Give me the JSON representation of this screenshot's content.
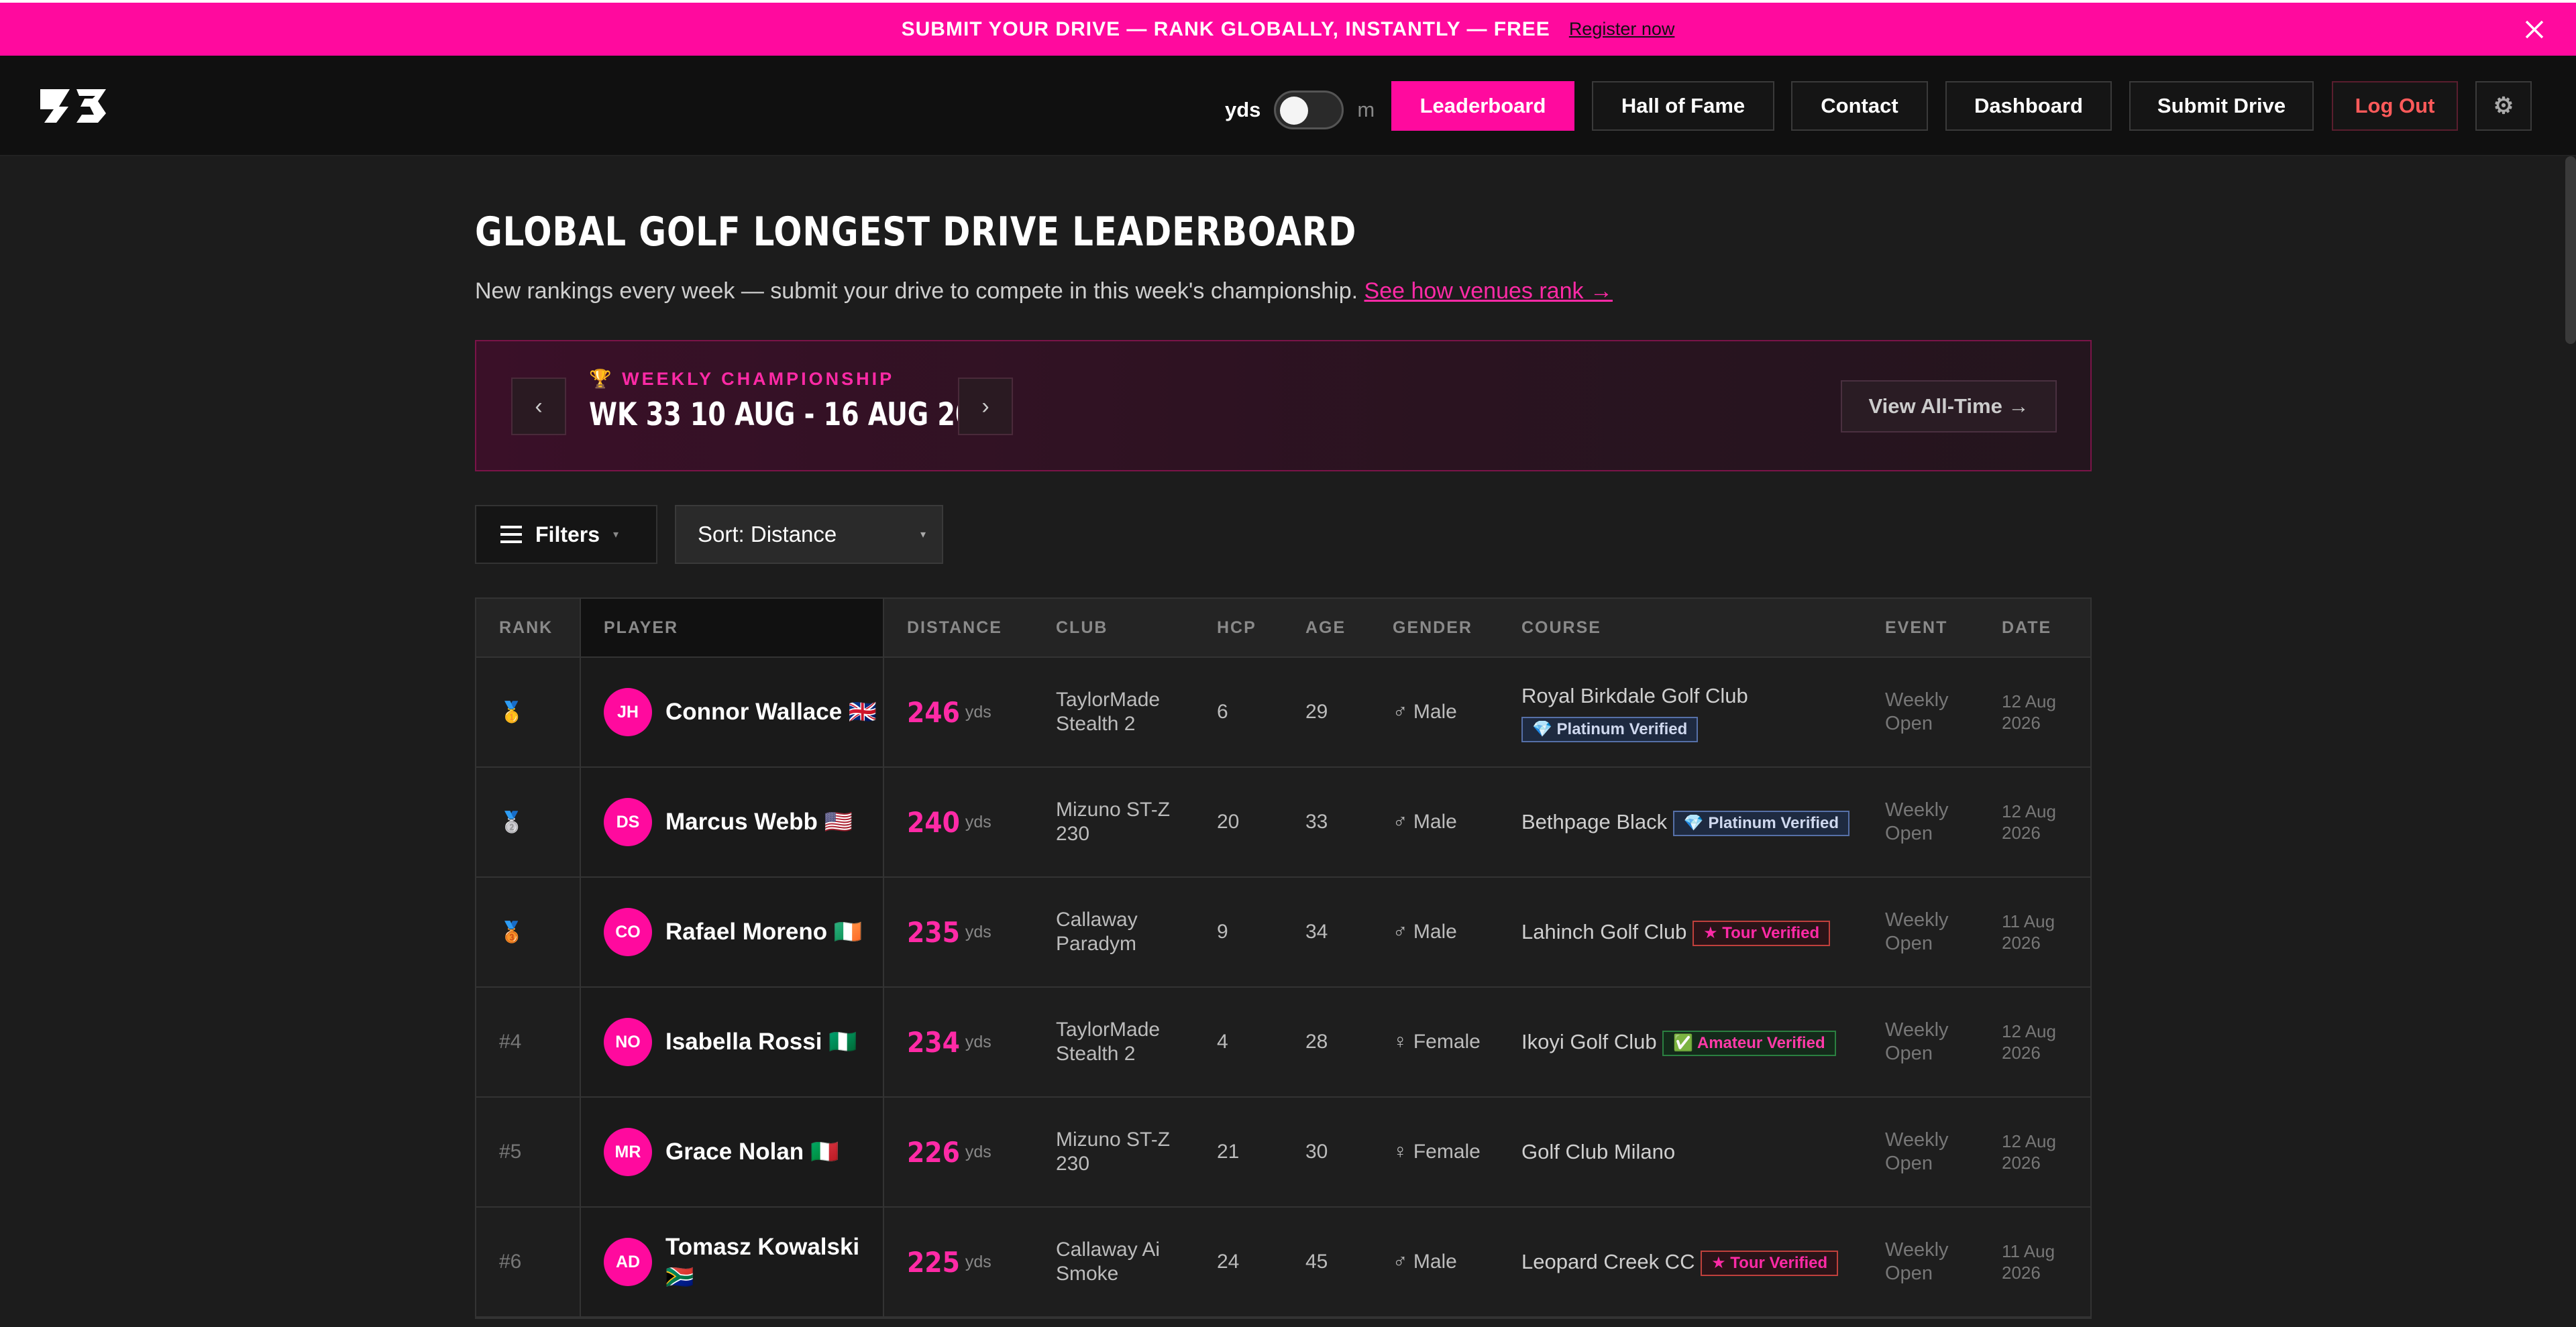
{
  "banner": {
    "text": "SUBMIT YOUR DRIVE — RANK GLOBALLY, INSTANTLY — FREE",
    "link": "Register now",
    "bg": "#ff0a9e"
  },
  "nav": {
    "unit_a": "yds",
    "unit_b": "m",
    "buttons": [
      "Leaderboard",
      "Hall of Fame",
      "Contact",
      "Dashboard",
      "Submit Drive",
      "Log Out"
    ],
    "active": "Leaderboard",
    "settings_icon": "⚙"
  },
  "page": {
    "title": "GLOBAL GOLF LONGEST DRIVE LEADERBOARD",
    "subtitle": "New rankings every week — submit your drive to compete in this week's championship.",
    "subtitle_link": "See how venues rank →"
  },
  "championship": {
    "label": "WEEKLY CHAMPIONSHIP",
    "trophy": "🏆",
    "week": "WK 33 10 AUG - 16 AUG 2026",
    "prev": "‹",
    "next": "›",
    "view_all": "View All-Time →"
  },
  "controls": {
    "filters": "Filters",
    "sort": "Sort: Distance"
  },
  "table": {
    "headers": [
      "RANK",
      "PLAYER",
      "DISTANCE",
      "CLUB",
      "HCP",
      "AGE",
      "GENDER",
      "COURSE",
      "EVENT",
      "DATE"
    ],
    "rows": [
      {
        "rank": "🥇",
        "initials": "JH",
        "name": "Connor Wallace",
        "flag": "🇬🇧",
        "distance": "246",
        "unit": "yds",
        "club": "TaylorMade Stealth 2",
        "hcp": "6",
        "age": "29",
        "gender": "♂ Male",
        "course": "Royal Birkdale Golf Club",
        "badge": "💎 Platinum Verified",
        "event": "Weekly Open",
        "date": "12 Aug 2026"
      },
      {
        "rank": "🥈",
        "initials": "DS",
        "name": "Marcus Webb",
        "flag": "🇺🇸",
        "distance": "240",
        "unit": "yds",
        "club": "Mizuno ST-Z 230",
        "hcp": "20",
        "age": "33",
        "gender": "♂ Male",
        "course": "Bethpage Black",
        "badge": "💎 Platinum Verified",
        "event": "Weekly Open",
        "date": "12 Aug 2026"
      },
      {
        "rank": "🥉",
        "initials": "CO",
        "name": "Rafael Moreno",
        "flag": "🇮🇪",
        "distance": "235",
        "unit": "yds",
        "club": "Callaway Paradym",
        "hcp": "9",
        "age": "34",
        "gender": "♂ Male",
        "course": "Lahinch Golf Club",
        "badge": "★ Tour Verified",
        "event": "Weekly Open",
        "date": "11 Aug 2026"
      },
      {
        "rank": "#4",
        "initials": "NO",
        "name": "Isabella Rossi",
        "flag": "🇳🇬",
        "distance": "234",
        "unit": "yds",
        "club": "TaylorMade Stealth 2",
        "hcp": "4",
        "age": "28",
        "gender": "♀ Female",
        "course": "Ikoyi Golf Club",
        "badge": "✅ Amateur Verified",
        "event": "Weekly Open",
        "date": "12 Aug 2026"
      },
      {
        "rank": "#5",
        "initials": "MR",
        "name": "Grace Nolan",
        "flag": "🇮🇹",
        "distance": "226",
        "unit": "yds",
        "club": "Mizuno ST-Z 230",
        "hcp": "21",
        "age": "30",
        "gender": "♀ Female",
        "course": "Golf Club Milano",
        "badge": "",
        "event": "Weekly Open",
        "date": "12 Aug 2026"
      },
      {
        "rank": "#6",
        "initials": "AD",
        "name": "Tomasz Kowalski",
        "flag": "🇿🇦",
        "distance": "225",
        "unit": "yds",
        "club": "Callaway Ai Smoke",
        "hcp": "24",
        "age": "45",
        "gender": "♂ Male",
        "course": "Leopard Creek CC",
        "badge": "★ Tour Verified",
        "event": "Weekly Open",
        "date": "11 Aug 2026"
      }
    ]
  }
}
